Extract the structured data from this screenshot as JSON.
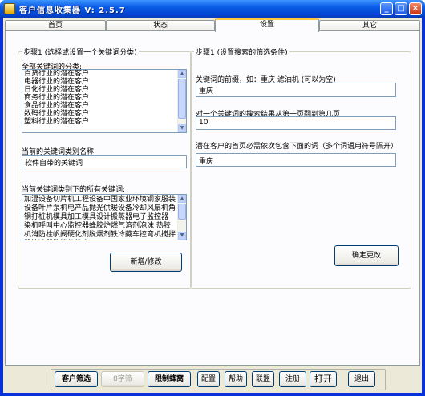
{
  "window": {
    "title": "客户信息收集器 V: 2.5.7",
    "minimize": "_",
    "maximize": "□",
    "close": "×"
  },
  "tabs": [
    "首页",
    "状态",
    "设置",
    "其它"
  ],
  "active_tab": "设置",
  "step1_category": {
    "legend": "步骤1 (选择或设置一个关键词分类)",
    "all_label": "全部关键词的分类:",
    "categories": [
      "百货行业的潜在客户",
      "电器行业的潜在客户",
      "日化行业的潜在客户",
      "商务行业的潜在客户",
      "食品行业的潜在客户",
      "数码行业的潜在客户",
      "塑料行业的潜在客户"
    ],
    "current_label": "当前的关键词类别名称:",
    "current_value": "软件自带的关键词",
    "keywords_label": "当前关键词类别下的所有关键词:",
    "keywords_text": "加湿设备切片机工程设备中国家业环境钢家服装设备叶片泵机电产品抛光供暖设备冷却风扇机角钢打桩机模具加工模具设计搬蒸器电子监控器 染机呼叫中心监控器蜂胶炉燃气溶剂泡沫 热胶机消防栓帆阀硬化剂脱烟剂铁冷藏车控弯机搅拌器箱选器搅拌机优度",
    "add_button": "新增/修改"
  },
  "step1_search": {
    "legend": "步骤1 (设置搜索的筛选条件)",
    "prefix_label": "关键词的前缀，如：重庆 滤油机 (可以为空)",
    "prefix_value": "重庆",
    "pages_label": "对一个关键词的搜索结果从第一页翻到第几页",
    "pages_value": "10",
    "homepage_label": "潜在客户的首页必需依次包含下面的词（多个词语用符号隔开）",
    "homepage_value": "重庆",
    "confirm_button": "确定更改"
  },
  "bottom_buttons": [
    {
      "label": "客户筛选",
      "bold": true,
      "disabled": false
    },
    {
      "label": "8字筛",
      "bold": false,
      "disabled": true
    },
    {
      "label": "限制蜂窝",
      "bold": true,
      "disabled": false
    },
    {
      "label": "配置",
      "bold": false,
      "disabled": false
    },
    {
      "label": "帮助",
      "bold": false,
      "disabled": false
    },
    {
      "label": "联盟",
      "bold": false,
      "disabled": false
    },
    {
      "label": "注册",
      "bold": false,
      "disabled": false
    },
    {
      "label": "打开",
      "bold": false,
      "disabled": false
    },
    {
      "label": "退出",
      "bold": false,
      "disabled": false
    }
  ]
}
